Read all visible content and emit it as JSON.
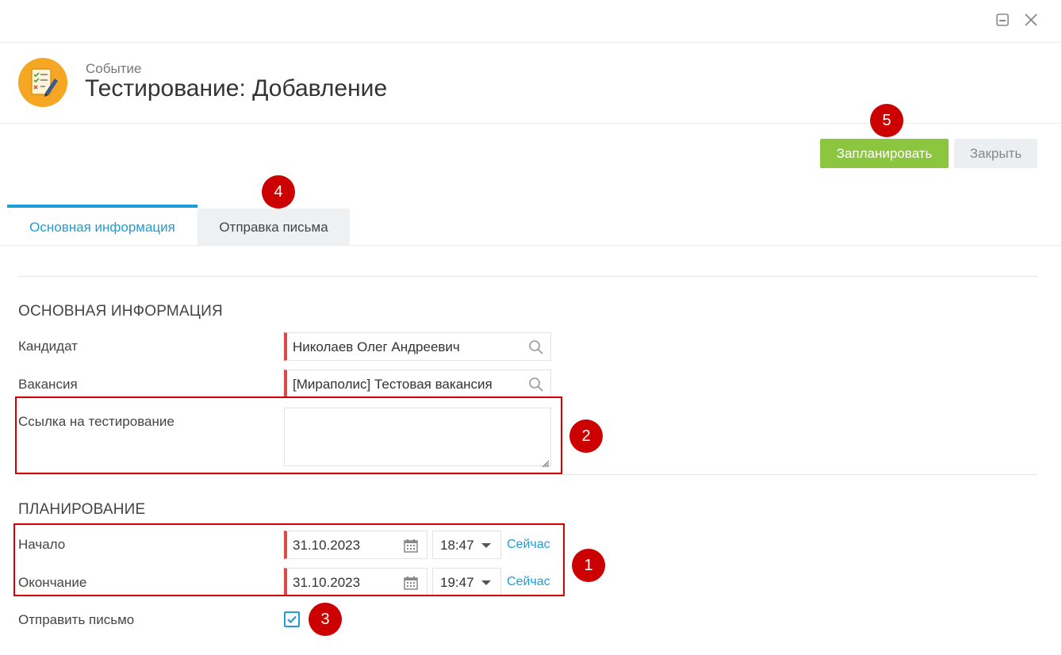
{
  "window": {
    "minimize_icon": "minimize-icon",
    "close_icon": "close-icon"
  },
  "header": {
    "subtitle": "Событие",
    "title": "Тестирование: Добавление",
    "icon": "checklist-pencil-icon",
    "icon_color": "#f5a623"
  },
  "actions": {
    "primary_label": "Запланировать",
    "secondary_label": "Закрыть",
    "primary_color": "#8cc63f"
  },
  "tabs": [
    {
      "label": "Основная информация",
      "active": true
    },
    {
      "label": "Отправка письма",
      "active": false
    }
  ],
  "sections": {
    "main": {
      "title": "ОСНОВНАЯ ИНФОРМАЦИЯ",
      "candidate_label": "Кандидат",
      "candidate_value": "Николаев Олег Андреевич",
      "vacancy_label": "Вакансия",
      "vacancy_value": "[Мираполис] Тестовая вакансия",
      "test_link_label": "Ссылка на тестирование",
      "test_link_value": ""
    },
    "planning": {
      "title": "ПЛАНИРОВАНИЕ",
      "start_label": "Начало",
      "start_date": "31.10.2023",
      "start_time": "18:47",
      "end_label": "Окончание",
      "end_date": "31.10.2023",
      "end_time": "19:47",
      "now_label": "Сейчас",
      "send_letter_label": "Отправить письмо",
      "send_letter_checked": true
    }
  },
  "annotations": [
    "1",
    "2",
    "3",
    "4",
    "5"
  ],
  "colors": {
    "accent": "#1e9ed8",
    "required": "#e04848",
    "annotation": "#cc0000"
  }
}
